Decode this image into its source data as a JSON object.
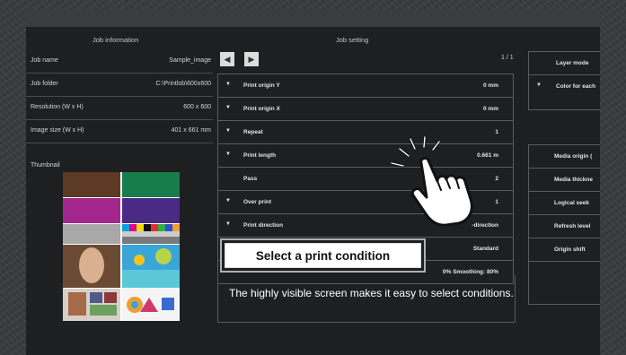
{
  "left_panel": {
    "header": "Job information",
    "rows": [
      {
        "label": "Job name",
        "value": "Sample_image"
      },
      {
        "label": "Job folder",
        "value": "C:\\Printlob\\600x600"
      },
      {
        "label": "Resolution (W x H)",
        "value": "600 x 600"
      },
      {
        "label": "Image size (W x H)",
        "value": "401 x 661 mm"
      }
    ],
    "thumbnail_label": "Thumbnail"
  },
  "center_panel": {
    "header": "Job setting",
    "page_indicator": "1 / 1",
    "settings": [
      {
        "label": "Print origin Y",
        "value": "0 mm",
        "expandable": true
      },
      {
        "label": "Print origin X",
        "value": "0 mm",
        "expandable": true
      },
      {
        "label": "Repeat",
        "value": "1",
        "expandable": true
      },
      {
        "label": "Print length",
        "value": "0.661 m",
        "expandable": true
      },
      {
        "label": "Pass",
        "value": "2",
        "expandable": false
      },
      {
        "label": "Over print",
        "value": "1",
        "expandable": true
      },
      {
        "label": "Print direction",
        "value": "-direction",
        "expandable": true
      },
      {
        "label": "",
        "value": "Standard",
        "expandable": false
      },
      {
        "label": "",
        "value": "0%   Smoothing: 80%",
        "expandable": false
      }
    ]
  },
  "right_panel": {
    "group1": [
      {
        "label": "Layer mode",
        "expandable": false
      },
      {
        "label": "Color for each",
        "expandable": true
      }
    ],
    "group2": [
      {
        "label": "Media origin (",
        "expandable": false
      },
      {
        "label": "Media thickne",
        "expandable": false
      },
      {
        "label": "Logical seek",
        "expandable": false
      },
      {
        "label": "Refresh level",
        "expandable": false
      },
      {
        "label": "Origin shift",
        "expandable": false
      }
    ]
  },
  "callout": {
    "title": "Select a print condition",
    "description": "The highly visible screen makes it easy to select conditions."
  },
  "icons": {
    "prev": "chevron-left-icon",
    "next": "chevron-right-icon",
    "tap": "hand-tap-icon"
  },
  "colors": {
    "screen_bg": "#1e1f21",
    "frame_bg": "#3a3b3d",
    "border": "#5a5b5d",
    "callout_bg": "#ffffff"
  }
}
